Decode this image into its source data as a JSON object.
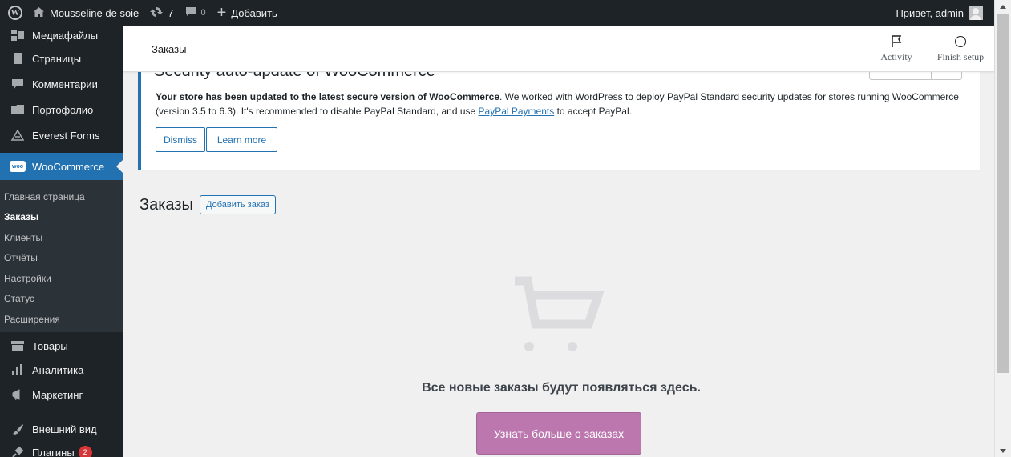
{
  "admin_bar": {
    "site_name": "Mousseline de soie",
    "updates_count": "7",
    "comments_count": "0",
    "new_label": "Добавить",
    "greeting": "Привет, admin",
    "icons": [
      "wordpress-logo-icon",
      "home-icon",
      "updates-icon",
      "comment-icon",
      "plus-icon"
    ]
  },
  "sidebar": {
    "items": [
      {
        "label": "Медиафайлы",
        "icon": "media-icon"
      },
      {
        "label": "Страницы",
        "icon": "page-icon"
      },
      {
        "label": "Комментарии",
        "icon": "comment-icon"
      },
      {
        "label": "Портофолио",
        "icon": "portfolio-icon"
      },
      {
        "label": "Everest Forms",
        "icon": "forms-icon"
      },
      {
        "label": "WooCommerce",
        "icon": "woo-icon",
        "active": true
      },
      {
        "label": "Товары",
        "icon": "products-icon"
      },
      {
        "label": "Аналитика",
        "icon": "analytics-icon"
      },
      {
        "label": "Маркетинг",
        "icon": "marketing-icon"
      },
      {
        "label": "Внешний вид",
        "icon": "appearance-icon"
      },
      {
        "label": "Плагины",
        "icon": "plugins-icon",
        "badge": "2"
      }
    ],
    "submenu": [
      {
        "label": "Главная страница"
      },
      {
        "label": "Заказы",
        "current": true
      },
      {
        "label": "Клиенты"
      },
      {
        "label": "Отчёты"
      },
      {
        "label": "Настройки"
      },
      {
        "label": "Статус"
      },
      {
        "label": "Расширения"
      }
    ],
    "woo_badge_text": "woo"
  },
  "header": {
    "title": "Заказы",
    "activity_label": "Activity",
    "finish_label": "Finish setup"
  },
  "notice": {
    "title": "Security auto-update of WooCommerce",
    "text_bold": "Your store has been updated to the latest secure version of WooCommerce",
    "text_1": ". We worked with WordPress to deploy PayPal Standard security updates for stores running WooCommerce (version 3.5 to 6.3). It's recommended to disable PayPal Standard, and use ",
    "link": "PayPal Payments",
    "text_2": " to accept PayPal.",
    "dismiss_label": "Dismiss",
    "learn_label": "Learn more"
  },
  "page": {
    "heading": "Заказы",
    "add_order_label": "Добавить заказ",
    "empty_message": "Все новые заказы будут появляться здесь.",
    "learn_orders_label": "Узнать больше о заказах"
  },
  "colors": {
    "admin_bg": "#1d2327",
    "accent": "#2271b1",
    "woo_purple": "#bb77ae"
  }
}
